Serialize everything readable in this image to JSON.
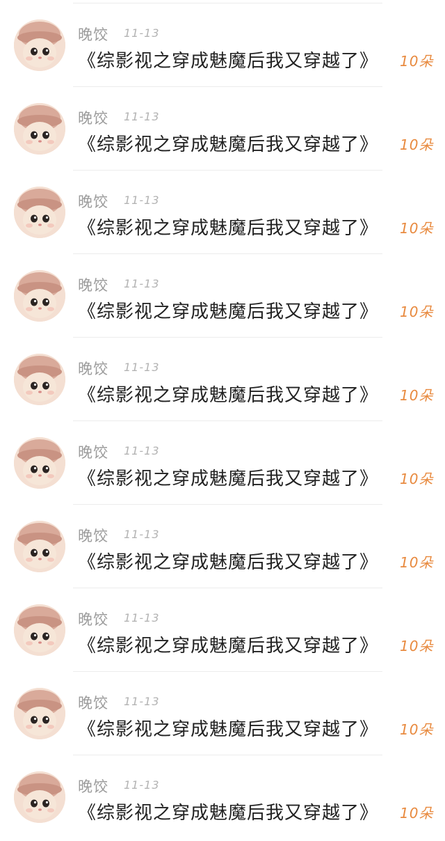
{
  "colors": {
    "username": "#9b9b9b",
    "date": "#b3b3b3",
    "title": "#222222",
    "gift": "#e88a3f",
    "divider": "#ececec"
  },
  "items": [
    {
      "avatar_icon": "kitten-in-hat-avatar",
      "user": "晚饺",
      "date": "11-13",
      "title": "《综影视之穿成魅魔后我又穿越了》",
      "gift": "10朵"
    },
    {
      "avatar_icon": "kitten-in-hat-avatar",
      "user": "晚饺",
      "date": "11-13",
      "title": "《综影视之穿成魅魔后我又穿越了》",
      "gift": "10朵"
    },
    {
      "avatar_icon": "kitten-in-hat-avatar",
      "user": "晚饺",
      "date": "11-13",
      "title": "《综影视之穿成魅魔后我又穿越了》",
      "gift": "10朵"
    },
    {
      "avatar_icon": "kitten-in-hat-avatar",
      "user": "晚饺",
      "date": "11-13",
      "title": "《综影视之穿成魅魔后我又穿越了》",
      "gift": "10朵"
    },
    {
      "avatar_icon": "kitten-in-hat-avatar",
      "user": "晚饺",
      "date": "11-13",
      "title": "《综影视之穿成魅魔后我又穿越了》",
      "gift": "10朵"
    },
    {
      "avatar_icon": "kitten-in-hat-avatar",
      "user": "晚饺",
      "date": "11-13",
      "title": "《综影视之穿成魅魔后我又穿越了》",
      "gift": "10朵"
    },
    {
      "avatar_icon": "kitten-in-hat-avatar",
      "user": "晚饺",
      "date": "11-13",
      "title": "《综影视之穿成魅魔后我又穿越了》",
      "gift": "10朵"
    },
    {
      "avatar_icon": "kitten-in-hat-avatar",
      "user": "晚饺",
      "date": "11-13",
      "title": "《综影视之穿成魅魔后我又穿越了》",
      "gift": "10朵"
    },
    {
      "avatar_icon": "kitten-in-hat-avatar",
      "user": "晚饺",
      "date": "11-13",
      "title": "《综影视之穿成魅魔后我又穿越了》",
      "gift": "10朵"
    },
    {
      "avatar_icon": "kitten-in-hat-avatar",
      "user": "晚饺",
      "date": "11-13",
      "title": "《综影视之穿成魅魔后我又穿越了》",
      "gift": "10朵"
    }
  ]
}
